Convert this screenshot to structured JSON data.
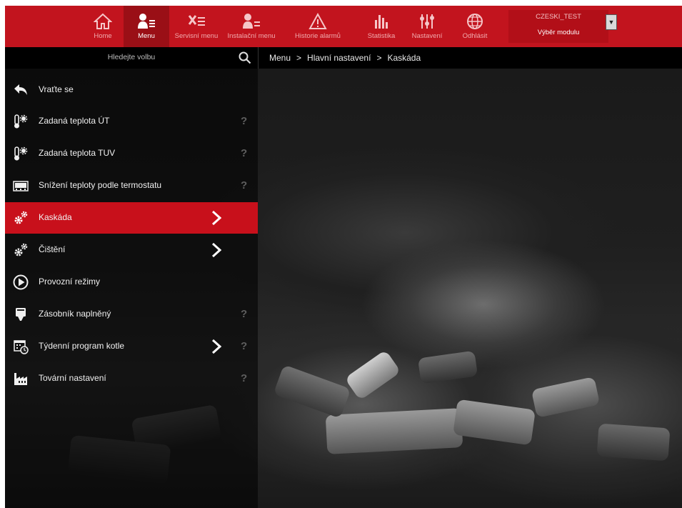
{
  "nav": [
    {
      "label": "Home",
      "icon": "home-icon",
      "active": false
    },
    {
      "label": "Menu",
      "icon": "menu-user-icon",
      "active": true
    },
    {
      "label": "Servisní menu",
      "icon": "service-tools-icon",
      "active": false
    },
    {
      "label": "Instalační menu",
      "icon": "installer-icon",
      "active": false
    },
    {
      "label": "Historie alarmů",
      "icon": "alarm-warning-icon",
      "active": false
    },
    {
      "label": "Statistika",
      "icon": "statistics-bars-icon",
      "active": false
    },
    {
      "label": "Nastavení",
      "icon": "settings-sliders-icon",
      "active": false
    },
    {
      "label": "Odhlásit",
      "icon": "globe-logout-icon",
      "active": false
    }
  ],
  "module": {
    "name": "CZESKI_TEST",
    "select_label": "Výběr modulu"
  },
  "search": {
    "placeholder": "Hledejte volbu",
    "icon": "search-icon"
  },
  "breadcrumb": [
    "Menu",
    ">",
    "Hlavní nastavení",
    ">",
    "Kaskáda"
  ],
  "menu": {
    "items": [
      {
        "label": "Vraťte se",
        "icon": "back-arrow-icon",
        "arrow": false,
        "help": false,
        "active": false
      },
      {
        "label": "Zadaná teplota ÚT",
        "icon": "thermometer-gear-icon",
        "arrow": false,
        "help": true,
        "active": false
      },
      {
        "label": "Zadaná teplota TUV",
        "icon": "thermometer-gear-icon",
        "arrow": false,
        "help": true,
        "active": false
      },
      {
        "label": "Snížení teploty podle termostatu",
        "icon": "thermostat-display-icon",
        "arrow": false,
        "help": true,
        "active": false
      },
      {
        "label": "Kaskáda",
        "icon": "gears-icon",
        "arrow": true,
        "help": false,
        "active": true
      },
      {
        "label": "Čištění",
        "icon": "gears-icon",
        "arrow": true,
        "help": false,
        "active": false
      },
      {
        "label": "Provozní režimy",
        "icon": "play-circle-icon",
        "arrow": false,
        "help": false,
        "active": false
      },
      {
        "label": "Zásobník naplněný",
        "icon": "hopper-icon",
        "arrow": false,
        "help": true,
        "active": false
      },
      {
        "label": "Týdenní program kotle",
        "icon": "calendar-clock-icon",
        "arrow": true,
        "help": true,
        "active": false
      },
      {
        "label": "Tovární nastavení",
        "icon": "factory-icon",
        "arrow": false,
        "help": true,
        "active": false
      }
    ],
    "help_symbol": "?"
  },
  "colors": {
    "brand_red": "#c2141e",
    "active_red": "#c8101b"
  }
}
